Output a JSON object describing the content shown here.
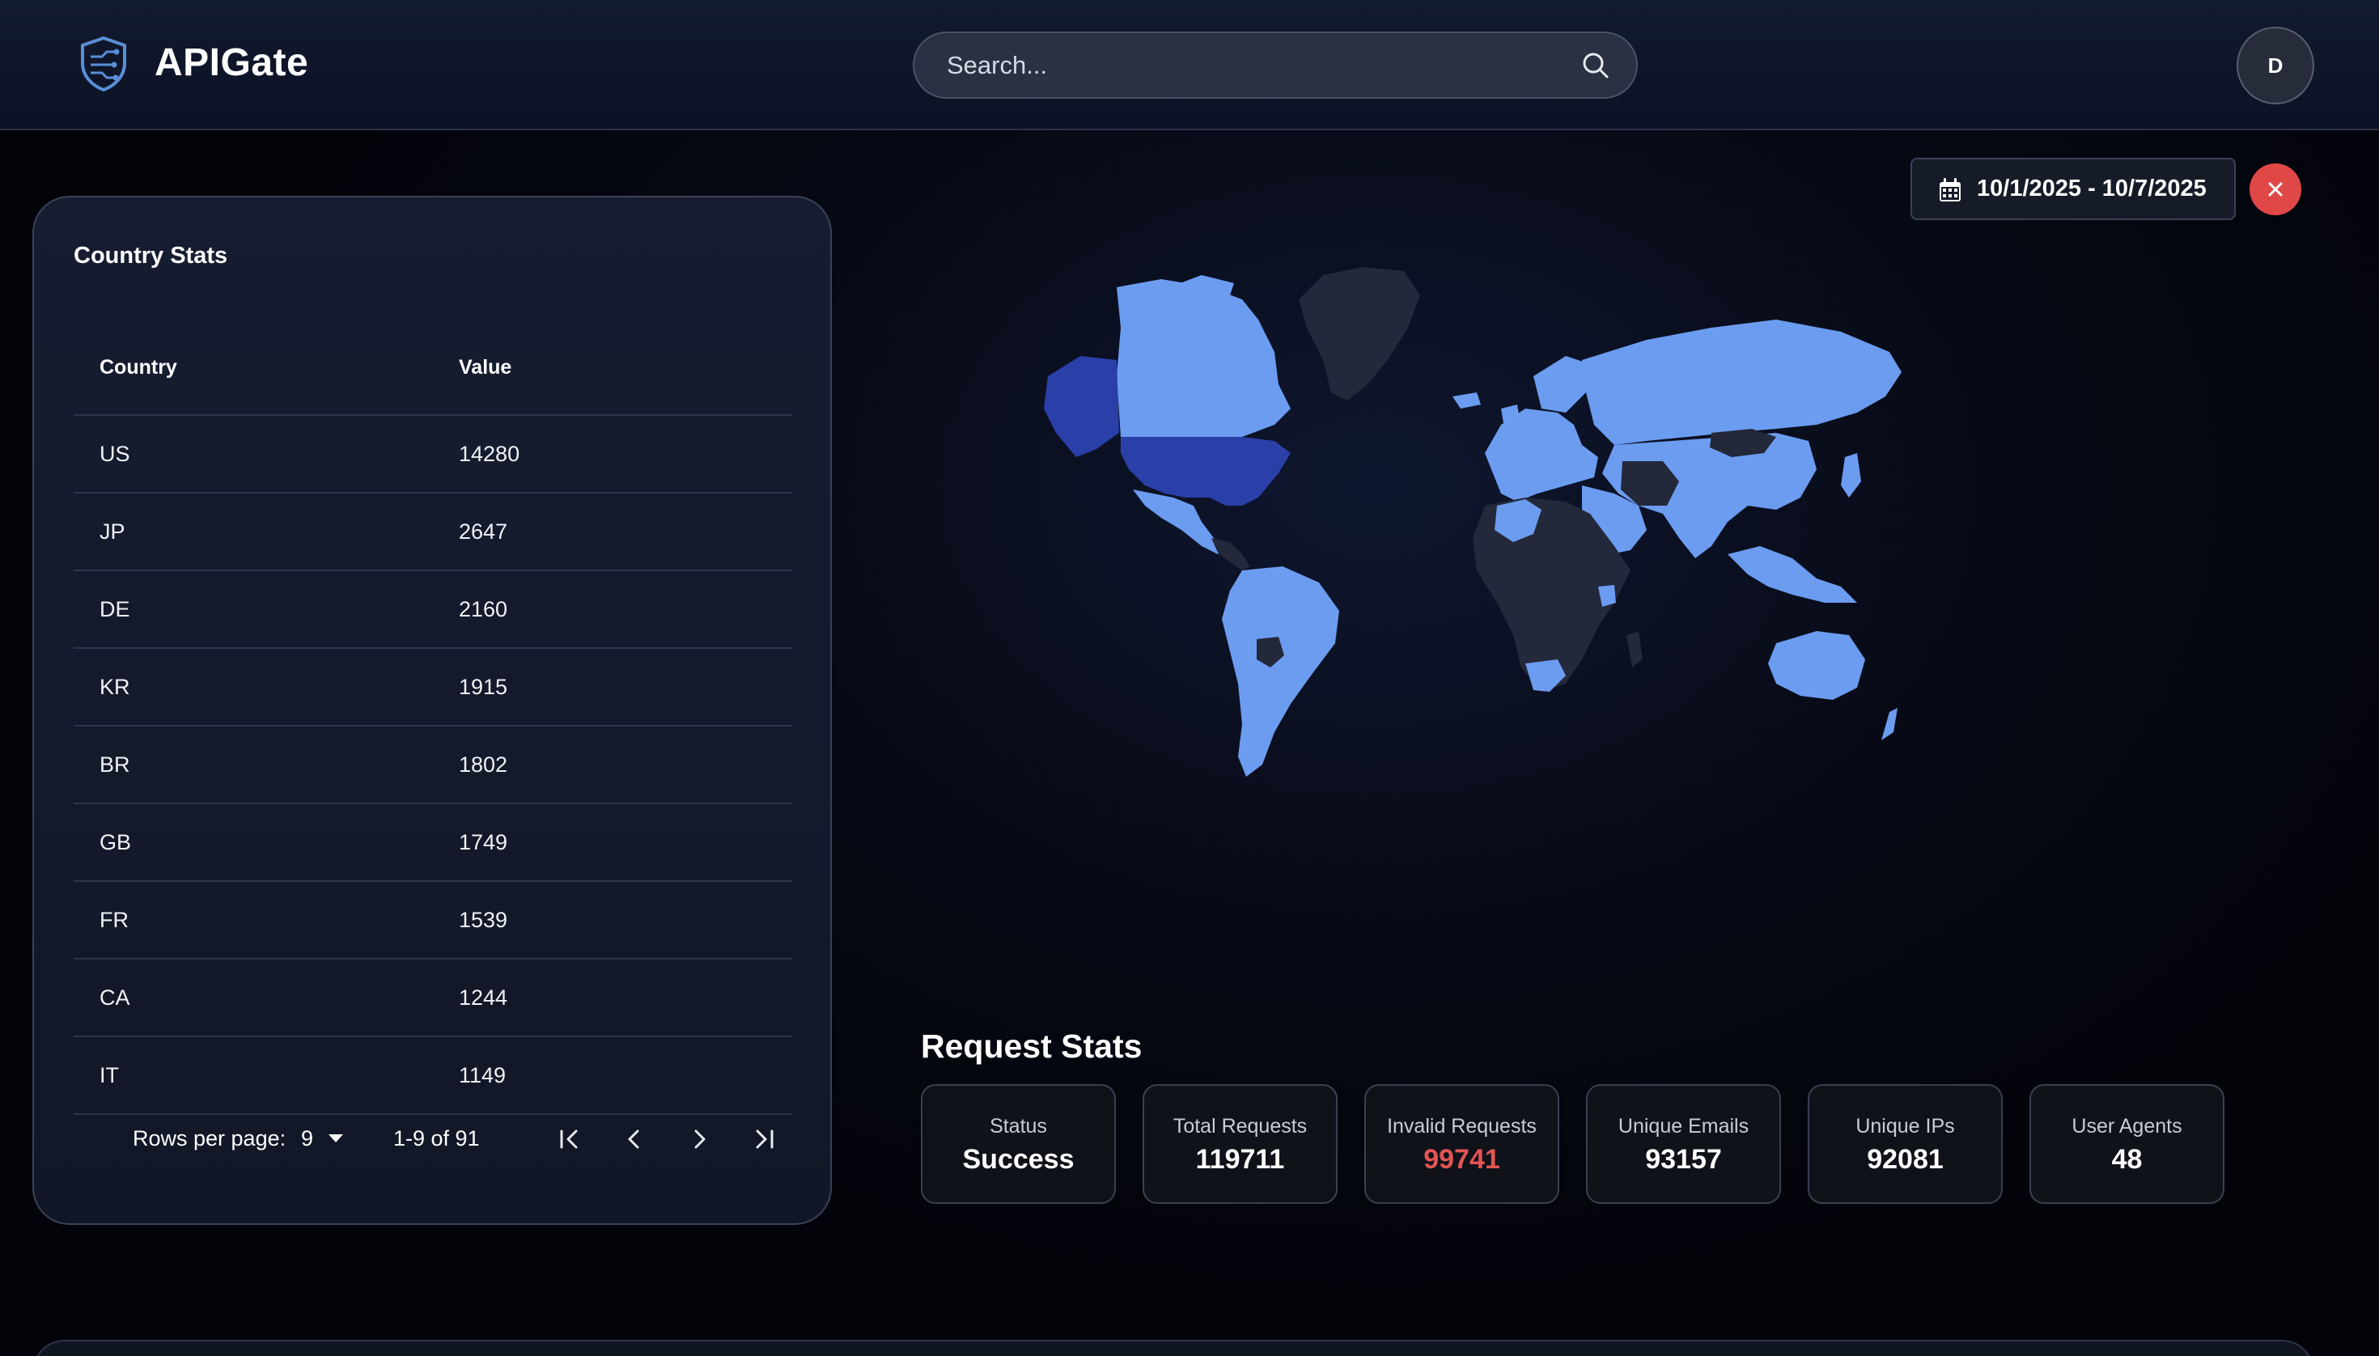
{
  "header": {
    "brand": "APIGate",
    "search_placeholder": "Search...",
    "avatar_initial": "D"
  },
  "country_stats": {
    "title": "Country Stats",
    "columns": [
      "Country",
      "Value"
    ],
    "rows": [
      {
        "country": "US",
        "value": "14280"
      },
      {
        "country": "JP",
        "value": "2647"
      },
      {
        "country": "DE",
        "value": "2160"
      },
      {
        "country": "KR",
        "value": "1915"
      },
      {
        "country": "BR",
        "value": "1802"
      },
      {
        "country": "GB",
        "value": "1749"
      },
      {
        "country": "FR",
        "value": "1539"
      },
      {
        "country": "CA",
        "value": "1244"
      },
      {
        "country": "IT",
        "value": "1149"
      }
    ],
    "pagination": {
      "rows_per_page_label": "Rows per page:",
      "rows_per_page": "9",
      "range": "1-9 of 91"
    }
  },
  "date_range": {
    "label": "10/1/2025 - 10/7/2025"
  },
  "request_stats": {
    "title": "Request Stats",
    "cards": [
      {
        "label": "Status",
        "value": "Success"
      },
      {
        "label": "Total Requests",
        "value": "119711"
      },
      {
        "label": "Invalid Requests",
        "value": "99741"
      },
      {
        "label": "Unique Emails",
        "value": "93157"
      },
      {
        "label": "Unique IPs",
        "value": "92081"
      },
      {
        "label": "User Agents",
        "value": "48"
      }
    ]
  },
  "colors": {
    "accent": "#6b9cf0",
    "highlight": "#2b3fa8",
    "danger": "#e45454",
    "no_data": "#23283a"
  }
}
